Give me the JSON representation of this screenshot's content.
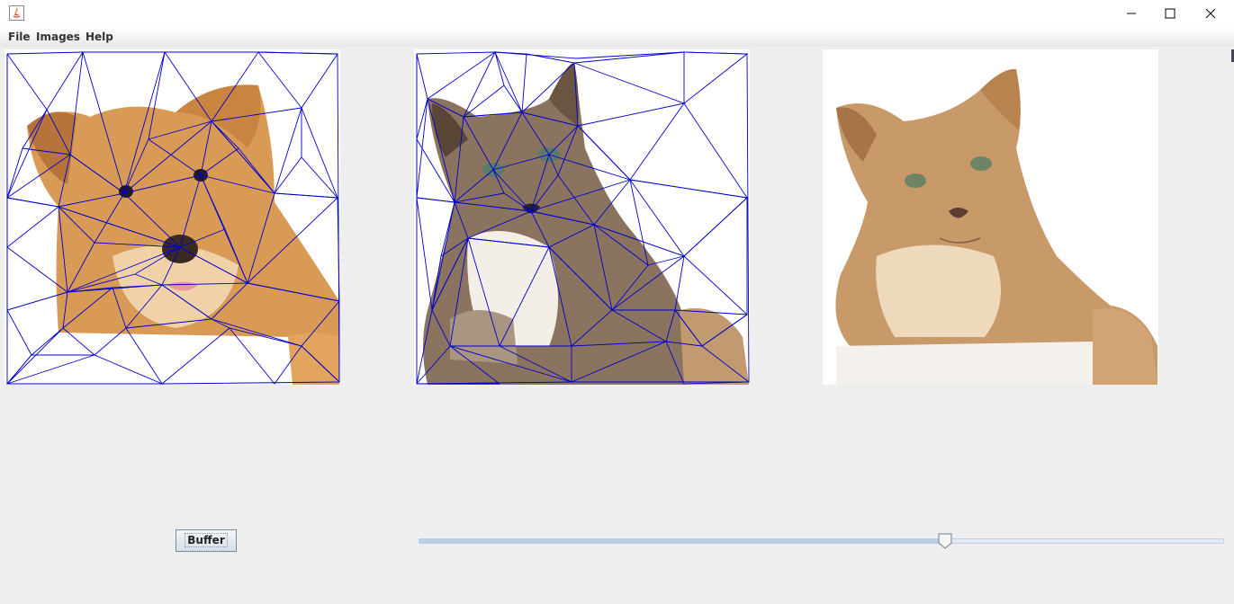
{
  "menu": {
    "file": "File",
    "images": "Images",
    "help": "Help"
  },
  "buttons": {
    "buffer": "Buffer"
  },
  "slider": {
    "value_fraction": 0.655
  },
  "colors": {
    "mesh": "#0000cc",
    "background": "#eeeeee"
  },
  "panels": {
    "source": {
      "subject": "dog-photo-with-triangle-mesh"
    },
    "destination": {
      "subject": "cat-photo-with-triangle-mesh"
    },
    "preview": {
      "subject": "morphed-cat-photo"
    }
  }
}
